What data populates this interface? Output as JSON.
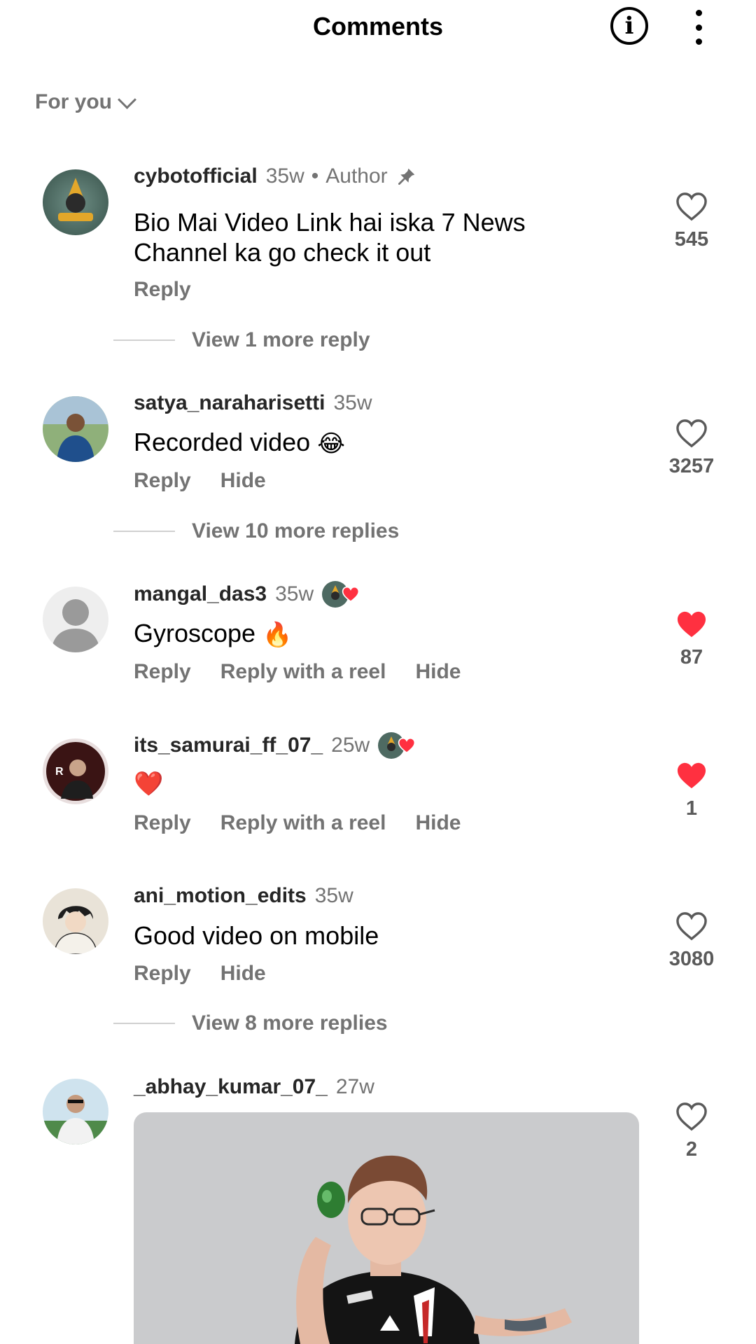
{
  "header": {
    "title": "Comments",
    "info_icon": "info-icon",
    "more_icon": "more-vertical-icon"
  },
  "filter": {
    "label": "For you"
  },
  "comments": [
    {
      "username": "cybotofficial",
      "time": "35w",
      "separator": "•",
      "badge": "Author",
      "text_line1": "Bio Mai Video Link hai iska 7 News",
      "text_line2": "Channel ka go check it out",
      "actions": [
        "Reply"
      ],
      "likes": "545",
      "liked": false,
      "view_more": "View 1 more reply"
    },
    {
      "username": "satya_naraharisetti",
      "time": "35w",
      "text": "Recorded video",
      "emoji": "😂",
      "actions": [
        "Reply",
        "Hide"
      ],
      "likes": "3257",
      "liked": false,
      "view_more": "View 10 more replies"
    },
    {
      "username": "mangal_das3",
      "time": "35w",
      "text": "Gyroscope",
      "emoji": "🔥",
      "actions": [
        "Reply",
        "Reply with a reel",
        "Hide"
      ],
      "likes": "87",
      "liked": true
    },
    {
      "username": "its_samurai_ff_07_",
      "time": "25w",
      "emoji": "❤️",
      "actions": [
        "Reply",
        "Reply with a reel",
        "Hide"
      ],
      "likes": "1",
      "liked": true
    },
    {
      "username": "ani_motion_edits",
      "time": "35w",
      "text": "Good video on mobile",
      "actions": [
        "Reply",
        "Hide"
      ],
      "likes": "3080",
      "liked": false,
      "view_more": "View 8 more replies"
    },
    {
      "username": "_abhay_kumar_07_",
      "time": "27w",
      "attachment": "gif",
      "likes": "2",
      "liked": false
    }
  ],
  "colors": {
    "like_red": "#ff3040",
    "secondary_text": "#737373"
  }
}
